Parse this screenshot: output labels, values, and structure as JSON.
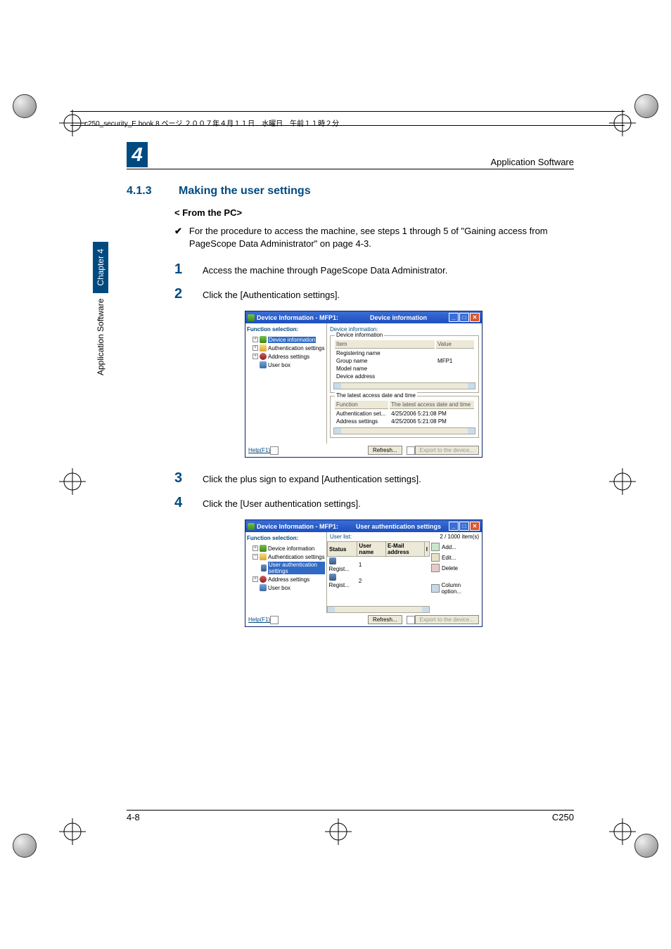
{
  "header_line": "c250_security_E.book  8 ページ  ２００７年４月１１日　水曜日　午前１１時２分",
  "running_title": "Application Software",
  "chapter_number": "4",
  "section": {
    "num": "4.1.3",
    "title": "Making the user settings"
  },
  "subhead": "< From the PC>",
  "bullet": "For the procedure to access the machine, see steps 1 through 5 of \"Gaining access from PageScope Data Administrator\" on page 4-3.",
  "steps": {
    "s1": {
      "num": "1",
      "text": "Access the machine through PageScope Data Administrator."
    },
    "s2": {
      "num": "2",
      "text": "Click the [Authentication settings]."
    },
    "s3": {
      "num": "3",
      "text": "Click the plus sign to expand [Authentication settings]."
    },
    "s4": {
      "num": "4",
      "text": "Click the [User authentication settings]."
    }
  },
  "win1": {
    "title_left": "Device Information - MFP1:",
    "title_center": "Device information",
    "nav_title": "Function selection:",
    "tree": {
      "dev_info": "Device information",
      "auth": "Authentication settings",
      "addr": "Address settings",
      "ubox": "User box"
    },
    "content_title": "Device information:",
    "group1_legend": "Device information",
    "cols": {
      "item": "Item",
      "value": "Value"
    },
    "rows": {
      "regname": "Registering name",
      "grpname": "Group name",
      "grpval": "MFP1",
      "model": "Model name",
      "devaddr": "Device address"
    },
    "group2_legend": "The latest access date and time",
    "cols2": {
      "func": "Function",
      "date": "The latest access date and time"
    },
    "rows2": {
      "auth": "Authentication set...",
      "authv": "4/25/2006 5:21:08 PM",
      "addr": "Address settings",
      "addrv": "4/25/2006 5:21:08 PM"
    },
    "help": "Help(F1)",
    "refresh": "Refresh...",
    "export": "Export to the device..."
  },
  "win2": {
    "title_left": "Device Information - MFP1:",
    "title_center": "User authentication settings",
    "nav_title": "Function selection:",
    "tree": {
      "dev_info": "Device information",
      "auth": "Authentication settings",
      "uauth": "User authentication settings",
      "addr": "Address settings",
      "ubox": "User box"
    },
    "list_label": "User list:",
    "count": "2 / 1000 item(s)",
    "cols": {
      "status": "Status",
      "uname": "User name",
      "email": "E-Mail address",
      "num": "I"
    },
    "rows": {
      "r1s": "Regist...",
      "r1n": "1",
      "r2s": "Regist...",
      "r2n": "2"
    },
    "btns": {
      "add": "Add...",
      "edit": "Edit...",
      "del": "Delete",
      "col": "Column option..."
    },
    "help": "Help(F1)",
    "refresh": "Refresh...",
    "export": "Export to the device..."
  },
  "side_tab": {
    "title": "Application Software",
    "chap": "Chapter 4"
  },
  "footer": {
    "left": "4-8",
    "right": "C250"
  }
}
